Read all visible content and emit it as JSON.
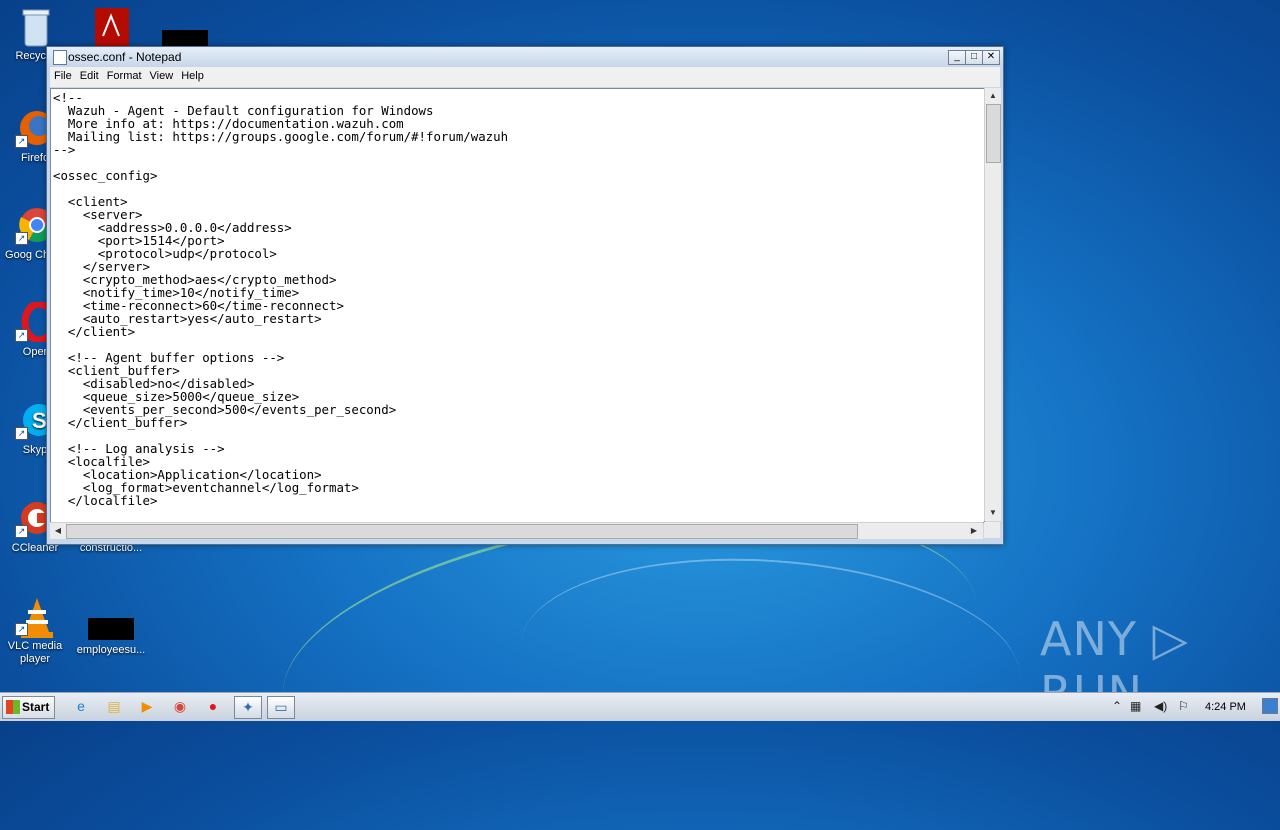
{
  "window": {
    "title": "ossec.conf - Notepad",
    "menu": [
      "File",
      "Edit",
      "Format",
      "View",
      "Help"
    ],
    "content": "<!--\n  Wazuh - Agent - Default configuration for Windows\n  More info at: https://documentation.wazuh.com\n  Mailing list: https://groups.google.com/forum/#!forum/wazuh\n-->\n\n<ossec_config>\n\n  <client>\n    <server>\n      <address>0.0.0.0</address>\n      <port>1514</port>\n      <protocol>udp</protocol>\n    </server>\n    <crypto_method>aes</crypto_method>\n    <notify_time>10</notify_time>\n    <time-reconnect>60</time-reconnect>\n    <auto_restart>yes</auto_restart>\n  </client>\n\n  <!-- Agent buffer options -->\n  <client_buffer>\n    <disabled>no</disabled>\n    <queue_size>5000</queue_size>\n    <events_per_second>500</events_per_second>\n  </client_buffer>\n\n  <!-- Log analysis -->\n  <localfile>\n    <location>Application</location>\n    <log_format>eventchannel</log_format>\n  </localfile>"
  },
  "desktop_icons": [
    {
      "label": "Recycle"
    },
    {
      "label": "Firefo"
    },
    {
      "label": "Goog Chron"
    },
    {
      "label": "Oper"
    },
    {
      "label": "Skyp"
    },
    {
      "label": "CCleaner"
    },
    {
      "label": "constructio..."
    },
    {
      "label": "VLC media player"
    },
    {
      "label": "employeesu..."
    }
  ],
  "taskbar": {
    "start_label": "Start",
    "clock": "4:24 PM"
  },
  "watermark": "ANY ▷ RUN"
}
